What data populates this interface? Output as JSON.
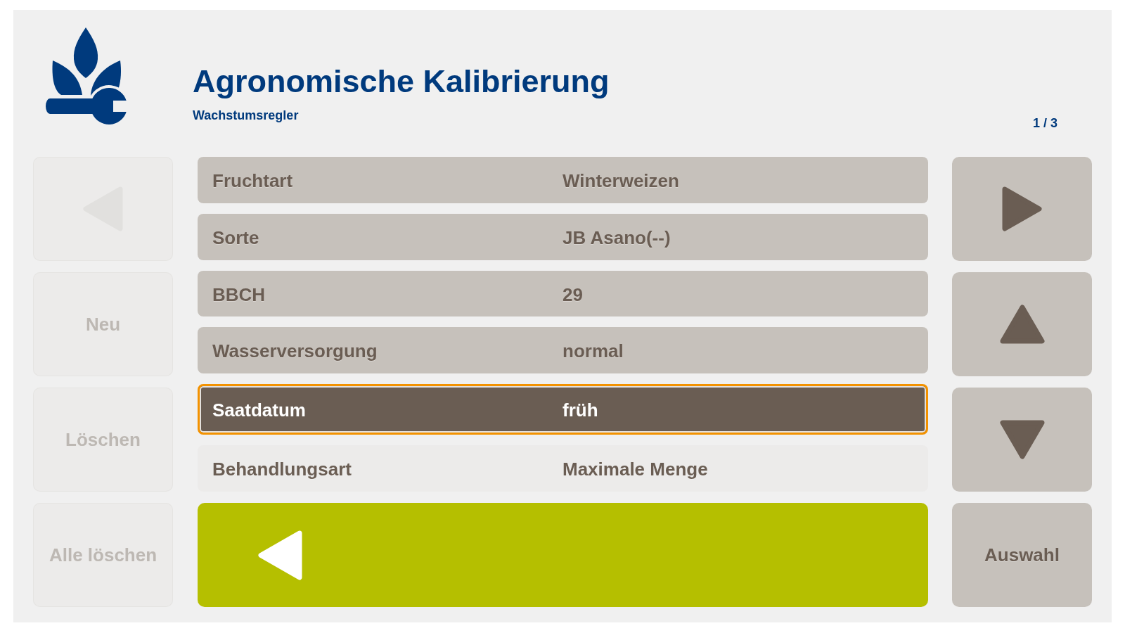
{
  "header": {
    "title": "Agronomische Kalibrierung",
    "subtitle": "Wachstumsregler",
    "page_indicator": "1 / 3"
  },
  "left_panel": {
    "previous_button": {
      "disabled": true
    },
    "buttons": [
      {
        "label": "Neu",
        "disabled": true
      },
      {
        "label": "Löschen",
        "disabled": true
      },
      {
        "label": "Alle löschen",
        "disabled": true
      }
    ]
  },
  "parameters": [
    {
      "label": "Fruchtart",
      "value": "Winterweizen",
      "selected": false,
      "editable": true
    },
    {
      "label": "Sorte",
      "value": "JB Asano(--)",
      "selected": false,
      "editable": true
    },
    {
      "label": "BBCH",
      "value": "29",
      "selected": false,
      "editable": true
    },
    {
      "label": "Wasserversorgung",
      "value": "normal",
      "selected": false,
      "editable": true
    },
    {
      "label": "Saatdatum",
      "value": "früh",
      "selected": true,
      "editable": true
    },
    {
      "label": "Behandlungsart",
      "value": "Maximale Menge",
      "selected": false,
      "editable": false
    }
  ],
  "right_panel": {
    "next_button": {
      "disabled": false
    },
    "scroll_up_button": {
      "disabled": false
    },
    "scroll_down_button": {
      "disabled": false
    },
    "select_button": {
      "label": "Auswahl",
      "disabled": false
    }
  }
}
